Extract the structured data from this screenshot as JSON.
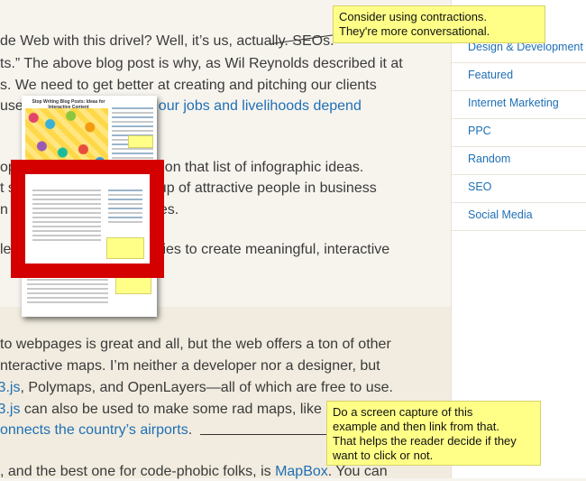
{
  "article": {
    "lines": [
      {
        "pre": "de Web with this drivel? Well, it’s us, actually. SEOs.",
        "link": "",
        "post": ""
      },
      {
        "pre": "ts.” The above blog post is why, as Wil Reynolds described it at",
        "link": "",
        "post": ""
      },
      {
        "pre": "s. We need to get better at creating and pitching our clients",
        "link": "",
        "post": ""
      },
      {
        "pre": "use",
        "link": "our jobs and livelihoods depend",
        "post": ""
      },
      {
        "pre": "op",
        "link": "",
        "post": "on that list of infographic ideas."
      },
      {
        "pre": "t s",
        "link": "",
        "post": "oup of attractive people in business"
      },
      {
        "pre": "n",
        "link": "",
        "post": "es."
      },
      {
        "pre": "le",
        "link": "",
        "post": "ies to create meaningful, interactive"
      },
      {
        "pre": "to webpages is great and all, but the web offers a ton of other",
        "link": "",
        "post": ""
      },
      {
        "pre": "nteractive maps. I’m neither a developer nor a designer, but",
        "link": "",
        "post": ""
      },
      {
        "pre": "",
        "link": "D3.js",
        "post": ", Polymaps, and OpenLayers—all of which are free to use."
      },
      {
        "pre": "",
        "link": "D3.js",
        "post": " can also be used to make some rad maps, like"
      },
      {
        "pre": "",
        "link": "onnects the country’s airports",
        "post": "."
      },
      {
        "pre": ", and the best one for code-phobic folks, is",
        "link": "MapBox",
        "post": ". You can"
      }
    ]
  },
  "sidebar": {
    "categories": [
      "Design & Development",
      "Featured",
      "Internet Marketing",
      "PPC",
      "Random",
      "SEO",
      "Social Media"
    ]
  },
  "notes": {
    "top": [
      "Consider using contractions.",
      "They're more conversational."
    ],
    "bottom": [
      "Do a screen capture of this",
      "example and then link from that.",
      "That helps the reader decide if they",
      "want to click or not."
    ]
  },
  "thumbnail": {
    "title": "Stop Writing Blog Posts: Ideas for Interactive Content"
  },
  "colors": {
    "link": "#1f6fb5",
    "note": "#ffff88",
    "highlight_frame": "#d40000"
  }
}
